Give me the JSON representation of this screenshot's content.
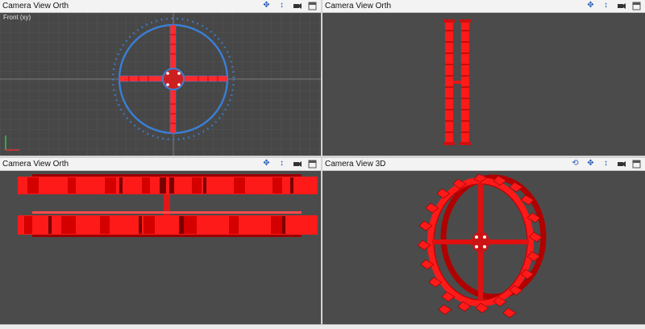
{
  "viewports": [
    {
      "title": "Camera  View  Orth",
      "label": "Front (xy)"
    },
    {
      "title": "Camera  View  Orth",
      "label": ""
    },
    {
      "title": "Camera  View  Orth",
      "label": ""
    },
    {
      "title": "Camera  View  3D",
      "label": ""
    }
  ],
  "icons": {
    "pan": "move-arrows-icon",
    "zoom": "zoom-arrows-icon",
    "camera": "camera-icon",
    "maximize": "maximize-icon",
    "orbit": "orbit-icon"
  },
  "colors": {
    "viewport_bg": "#4b4b4b",
    "model_red": "#ff1a1a",
    "model_dark_red": "#8b0000",
    "selection_blue": "#3a7fd6",
    "grid": "#5a5a5a"
  }
}
